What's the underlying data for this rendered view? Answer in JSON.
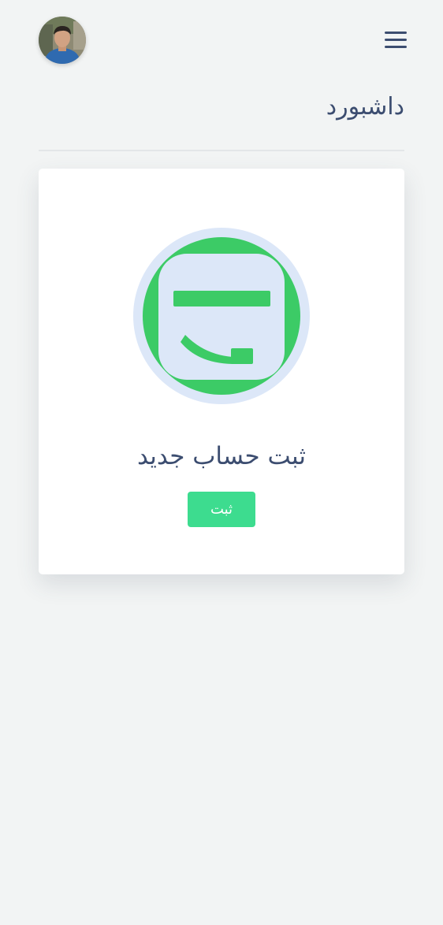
{
  "header": {
    "avatar_icon": "user-avatar-photo",
    "menu_icon": "hamburger-menu-icon"
  },
  "page": {
    "title": "داشبورد"
  },
  "card": {
    "icon": "app-logo-icon",
    "title": "ثبت حساب جدید",
    "button_label": "ثبت"
  },
  "colors": {
    "background": "#f2f4f4",
    "text": "#3c4d70",
    "accent_green": "#3ccb66",
    "button_green": "#3ddc8f",
    "icon_ring": "#dce7f8"
  }
}
